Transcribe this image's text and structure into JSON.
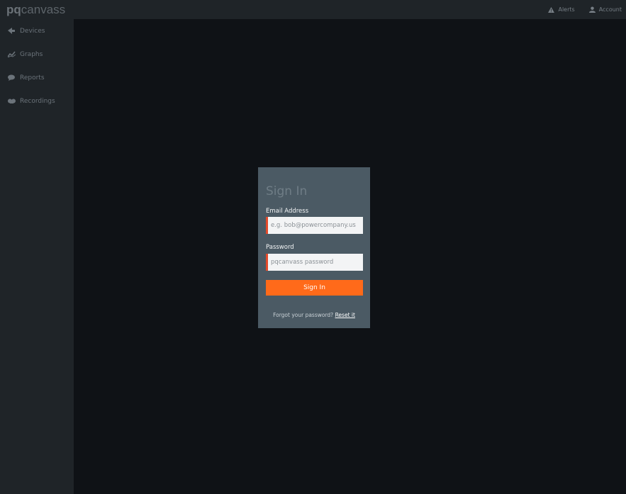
{
  "app": {
    "logo_part1": "pq",
    "logo_part2": "canvass"
  },
  "topbar": {
    "alerts_label": "Alerts",
    "account_label": "Account"
  },
  "sidebar": {
    "items": [
      {
        "label": "Devices",
        "icon": "devices-icon"
      },
      {
        "label": "Graphs",
        "icon": "graphs-icon"
      },
      {
        "label": "Reports",
        "icon": "reports-icon"
      },
      {
        "label": "Recordings",
        "icon": "recordings-icon"
      }
    ]
  },
  "signin": {
    "title": "Sign In",
    "email_label": "Email Address",
    "email_value": "",
    "email_placeholder": "e.g. bob@powercompany.us",
    "password_label": "Password",
    "password_value": "",
    "password_placeholder": "pqcanvass password",
    "button_label": "Sign In",
    "forgot_text": "Forgot your password?",
    "reset_link": "Reset it"
  },
  "colors": {
    "topbar_bg": "#1f2428",
    "sidebar_bg": "#1f2428",
    "main_bg": "#0f1216",
    "card_bg": "#4b5a64",
    "accent_orange": "#ff6a1a",
    "input_error_border": "#e44a2b"
  }
}
